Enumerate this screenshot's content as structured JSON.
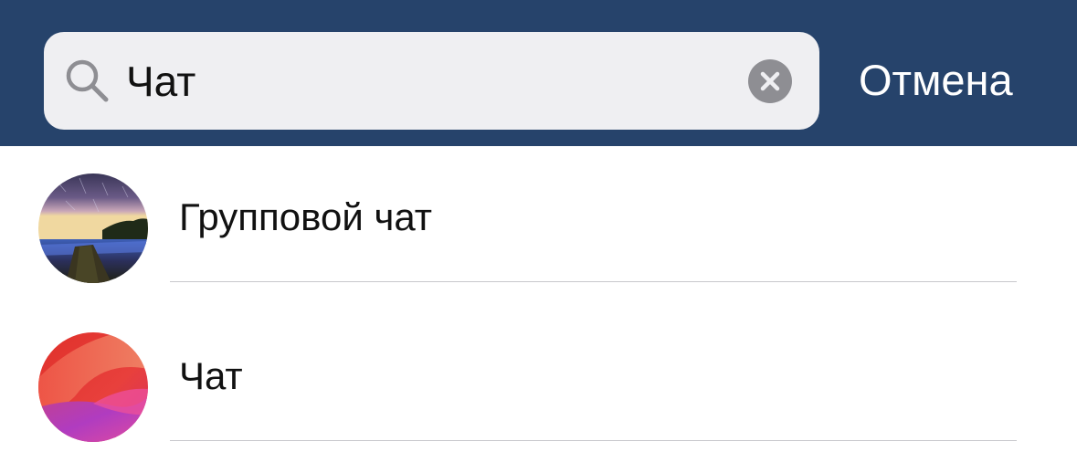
{
  "colors": {
    "header_bg": "#26436b",
    "search_bg": "#efeff2",
    "cancel_text": "#ffffff",
    "clear_button": "#8e8e93",
    "separator": "#c8c8cc"
  },
  "search": {
    "value": "Чат",
    "icon": "search-icon",
    "clear_icon": "clear-circle-icon",
    "cancel_label": "Отмена"
  },
  "results": [
    {
      "title": "Групповой чат",
      "avatar": "night-sky-field-photo"
    },
    {
      "title": "Чат",
      "avatar": "red-pink-gradient-wallpaper"
    }
  ]
}
